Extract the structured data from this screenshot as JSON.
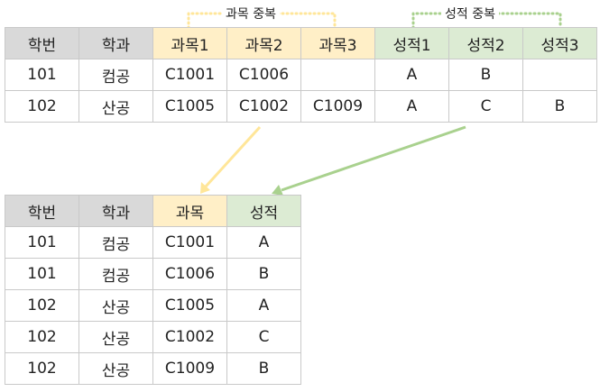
{
  "colors": {
    "header_gray": "#d9d9d9",
    "subject_highlight": "#ffefc7",
    "grade_highlight": "#dcebd3",
    "subject_arrow": "#ffe699",
    "grade_arrow": "#a9d18e",
    "grid_border": "#c9c9c9"
  },
  "top_table": {
    "headers": [
      "학번",
      "학과",
      "과목1",
      "과목2",
      "과목3",
      "성적1",
      "성적2",
      "성적3"
    ],
    "rows": [
      [
        "101",
        "컴공",
        "C1001",
        "C1006",
        "",
        "A",
        "B",
        ""
      ],
      [
        "102",
        "산공",
        "C1005",
        "C1002",
        "C1009",
        "A",
        "C",
        "B"
      ]
    ]
  },
  "group_labels": {
    "subject": "과목 중복",
    "grade": "성적 중복"
  },
  "bottom_table": {
    "headers": [
      "학번",
      "학과",
      "과목",
      "성적"
    ],
    "rows": [
      [
        "101",
        "컴공",
        "C1001",
        "A"
      ],
      [
        "101",
        "컴공",
        "C1006",
        "B"
      ],
      [
        "102",
        "산공",
        "C1005",
        "A"
      ],
      [
        "102",
        "산공",
        "C1002",
        "C"
      ],
      [
        "102",
        "산공",
        "C1009",
        "B"
      ]
    ]
  }
}
